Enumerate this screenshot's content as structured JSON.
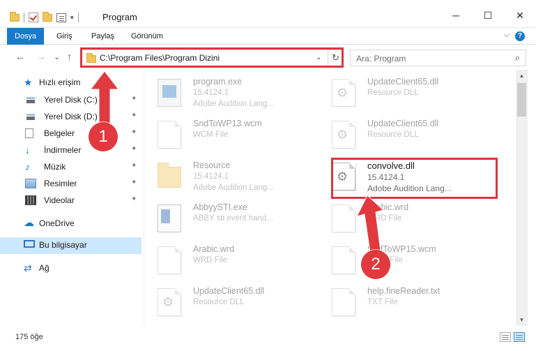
{
  "window": {
    "title": "Program",
    "minimize": "─",
    "maximize": "☐",
    "close": "✕"
  },
  "ribbon": {
    "tabs": [
      "Dosya",
      "Giriş",
      "Paylaş",
      "Görünüm"
    ],
    "expand": "⌵",
    "help": "?"
  },
  "nav": {
    "back": "←",
    "forward": "→",
    "recent": "⌄",
    "up": "↑",
    "address": "C:\\Program Files\\Program Dizini",
    "address_dropdown": "⌄",
    "refresh": "↻",
    "search_placeholder": "Ara: Program",
    "search_icon": "search-icon"
  },
  "sidebar": {
    "quick_access": "Hızlı erişim",
    "items": [
      {
        "label": "Yerel Disk (C:)",
        "icon": "disk-icon"
      },
      {
        "label": "Yerel Disk (D:)",
        "icon": "disk-icon"
      },
      {
        "label": "Belgeler",
        "icon": "documents-icon"
      },
      {
        "label": "İndirmeler",
        "icon": "downloads-icon"
      },
      {
        "label": "Müzik",
        "icon": "music-icon"
      },
      {
        "label": "Resimler",
        "icon": "pictures-icon"
      },
      {
        "label": "Videolar",
        "icon": "videos-icon"
      }
    ],
    "pin": "📌",
    "onedrive": "OneDrive",
    "this_pc": "Bu bilgisayar",
    "network": "Ağ"
  },
  "files": [
    {
      "name": "program.exe",
      "line2": "15.4124.1",
      "line3": "Adobe Audition Lang...",
      "icon": "exe"
    },
    {
      "name": "UpdateClient65.dll",
      "line2": "Resource DLL",
      "line3": "",
      "icon": "dll"
    },
    {
      "name": "SndToWP13.wcm",
      "line2": "WCM File",
      "line3": "",
      "icon": "page"
    },
    {
      "name": "UpdateClient65.dll",
      "line2": "Resource DLL",
      "line3": "",
      "icon": "dll"
    },
    {
      "name": "Resource",
      "line2": "15.4124.1",
      "line3": "Adobe Audition Lang...",
      "icon": "folder"
    },
    {
      "name": "convolve.dll",
      "line2": "15.4124.1",
      "line3": "Adobe Audition Lang...",
      "icon": "dll"
    },
    {
      "name": "AbbyySTI.exe",
      "line2": "ABBY sti event hand...",
      "line3": "",
      "icon": "abbyy"
    },
    {
      "name": "Arabic.wrd",
      "line2": "WRD File",
      "line3": "",
      "icon": "page"
    },
    {
      "name": "Arabic.wrd",
      "line2": "WRD File",
      "line3": "",
      "icon": "page"
    },
    {
      "name": "SndToWP15.wcm",
      "line2": "WCM File",
      "line3": "",
      "icon": "page"
    },
    {
      "name": "UpdateClient65.dll",
      "line2": "Resource DLL",
      "line3": "",
      "icon": "dll"
    },
    {
      "name": "help.fineReader.txt",
      "line2": "TXT File",
      "line3": "",
      "icon": "page"
    }
  ],
  "status": {
    "count": "175 öğe"
  },
  "annotations": {
    "step1": "1",
    "step2": "2",
    "accent": "#d9363e"
  },
  "colors": {
    "accent": "#1979ca",
    "selected": "#cce8ff"
  }
}
